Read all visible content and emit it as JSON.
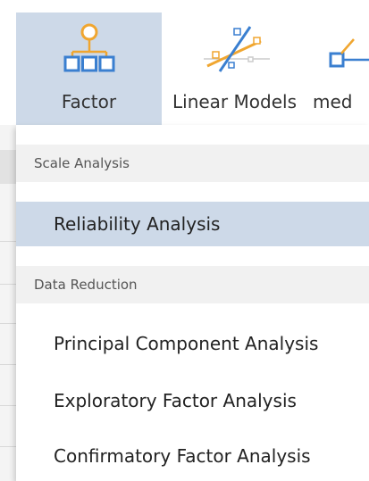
{
  "ribbon": {
    "items": [
      {
        "label": "Factor",
        "icon": "factor-hierarchy-icon",
        "active": true
      },
      {
        "label": "Linear Models",
        "icon": "linear-models-icon",
        "active": false
      },
      {
        "label": "med",
        "icon": "mediation-icon",
        "active": false
      }
    ]
  },
  "menu": {
    "sections": [
      {
        "header": "Scale Analysis",
        "items": [
          "Reliability Analysis"
        ]
      },
      {
        "header": "Data Reduction",
        "items": [
          "Principal Component Analysis",
          "Exploratory Factor Analysis",
          "Confirmatory Factor Analysis"
        ]
      }
    ]
  },
  "colors": {
    "active_background": "#cdd9e8",
    "icon_blue": "#3a7fd0",
    "icon_orange": "#f0a630",
    "section_header_bg": "#f1f1f1"
  }
}
